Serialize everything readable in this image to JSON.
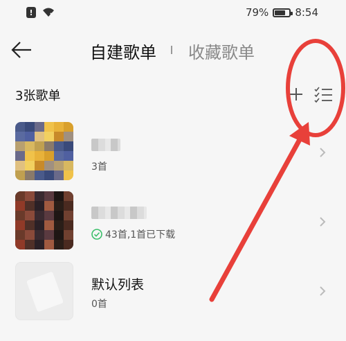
{
  "status_bar": {
    "battery_percent": "79%",
    "battery_level": 0.79,
    "time": "8:54",
    "icons": [
      "alert-icon",
      "wifi-icon",
      "battery-icon"
    ]
  },
  "header": {
    "back_icon": "back-arrow-icon",
    "tabs": [
      {
        "label": "自建歌单",
        "active": true
      },
      {
        "label": "收藏歌单",
        "active": false
      }
    ]
  },
  "toolbar": {
    "count_label": "3张歌单",
    "add_icon": "plus-icon",
    "manage_icon": "checklist-icon"
  },
  "playlists": [
    {
      "name": "",
      "name_obscured": true,
      "subtitle": "3首",
      "cover": "pixelated"
    },
    {
      "name": "",
      "name_obscured": true,
      "subtitle": "43首,1首已下载",
      "downloaded_badge": "check-circle-icon",
      "cover": "pixelated"
    },
    {
      "name": "默认列表",
      "name_obscured": false,
      "subtitle": "0首",
      "cover": "default"
    }
  ],
  "colors": {
    "background": "#f6f6f6",
    "annotation_red": "#e8403a",
    "download_green": "#3bbf6a",
    "text_primary": "#111111",
    "text_secondary": "#888888"
  }
}
